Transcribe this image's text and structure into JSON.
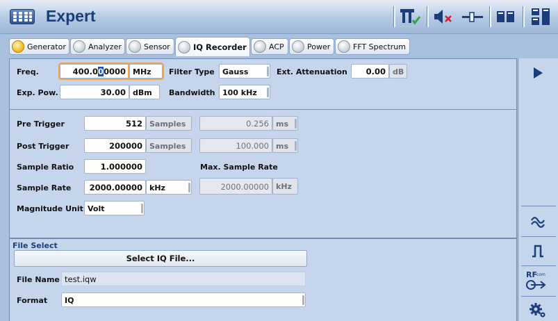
{
  "window": {
    "title": "Expert"
  },
  "toolbar": {
    "items": [
      "t-check-icon",
      "mute-icon",
      "slider-icon",
      "panels-icon",
      "split-icon"
    ]
  },
  "tabs": [
    {
      "label": "Generator",
      "led": "on"
    },
    {
      "label": "Analyzer",
      "led": "off"
    },
    {
      "label": "Sensor",
      "led": "off"
    },
    {
      "label": "IQ Recorder",
      "led": "off",
      "active": true
    },
    {
      "label": "ACP",
      "led": "off"
    },
    {
      "label": "Power",
      "led": "off"
    },
    {
      "label": "FFT Spectrum",
      "led": "off"
    }
  ],
  "top": {
    "freq_label": "Freq.",
    "freq_pre": "400.0",
    "freq_cursor": "0",
    "freq_post": "0000",
    "freq_unit": "MHz",
    "exppow_label": "Exp. Pow.",
    "exppow_value": "30.00",
    "exppow_unit": "dBm",
    "filter_label": "Filter Type",
    "filter_value": "Gauss",
    "bandwidth_label": "Bandwidth",
    "bandwidth_value": "100 kHz",
    "extatt_label": "Ext. Attenuation",
    "extatt_value": "0.00",
    "extatt_unit": "dB"
  },
  "trigger": {
    "pre_label": "Pre Trigger",
    "pre_value": "512",
    "pre_unit": "Samples",
    "pre_time": "0.256",
    "pre_time_unit": "ms",
    "post_label": "Post Trigger",
    "post_value": "200000",
    "post_unit": "Samples",
    "post_time": "100.000",
    "post_time_unit": "ms",
    "ratio_label": "Sample Ratio",
    "ratio_value": "1.000000",
    "maxrate_label": "Max. Sample Rate",
    "rate_label": "Sample Rate",
    "rate_value": "2000.00000",
    "rate_unit": "kHz",
    "maxrate_value": "2000.00000",
    "maxrate_unit": "kHz",
    "mag_label": "Magnitude Unit",
    "mag_value": "Volt"
  },
  "file": {
    "section_title": "File Select",
    "select_button": "Select IQ File...",
    "name_label": "File Name",
    "name_value": "test.iqw",
    "format_label": "Format",
    "format_value": "IQ"
  },
  "side": {
    "rf_text": "RF",
    "rf_sub": "com"
  },
  "colors": {
    "title_text": "#1d3c7a",
    "background": "#a9c1de",
    "panel": "#c5d6ec",
    "focus": "#f0a34a",
    "active_led": "#f3c02a"
  }
}
